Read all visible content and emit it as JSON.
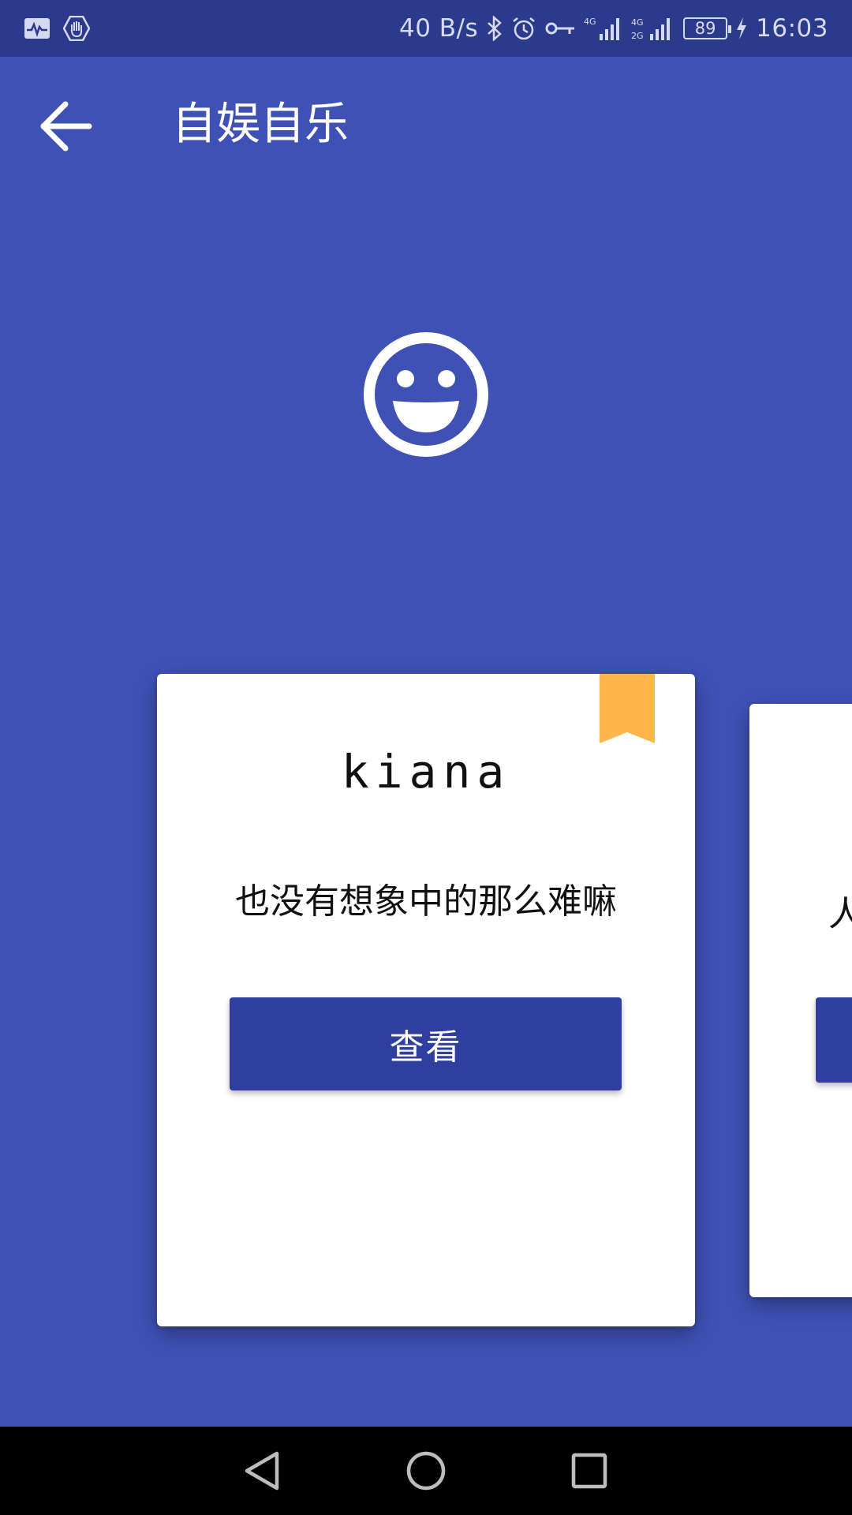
{
  "status_bar": {
    "net_speed": "40 B/s",
    "battery": "89",
    "time": "16:03",
    "icons": [
      "activity-icon",
      "hand-stop-icon",
      "bluetooth-icon",
      "alarm-icon",
      "key-icon",
      "signal-4g-icon",
      "signal-4g-2g-icon",
      "battery-icon",
      "charging-icon"
    ]
  },
  "toolbar": {
    "title": "自娱自乐",
    "back_icon": "arrow-left-icon"
  },
  "hero": {
    "icon": "smiley-icon"
  },
  "cards": [
    {
      "name": "kiana",
      "message": "也没有想象中的那么难嘛",
      "button_label": "查看",
      "bookmark_color": "#FFB74D"
    },
    {
      "message_partial": "人",
      "button_label": ""
    }
  ],
  "nav_bar": {
    "icons": [
      "back-triangle-icon",
      "home-circle-icon",
      "recents-square-icon"
    ]
  },
  "colors": {
    "primary": "#3F51B5",
    "primary_dark": "#303F9F",
    "status_bar": "#2C3A8C",
    "accent_bookmark": "#FFB74D"
  }
}
